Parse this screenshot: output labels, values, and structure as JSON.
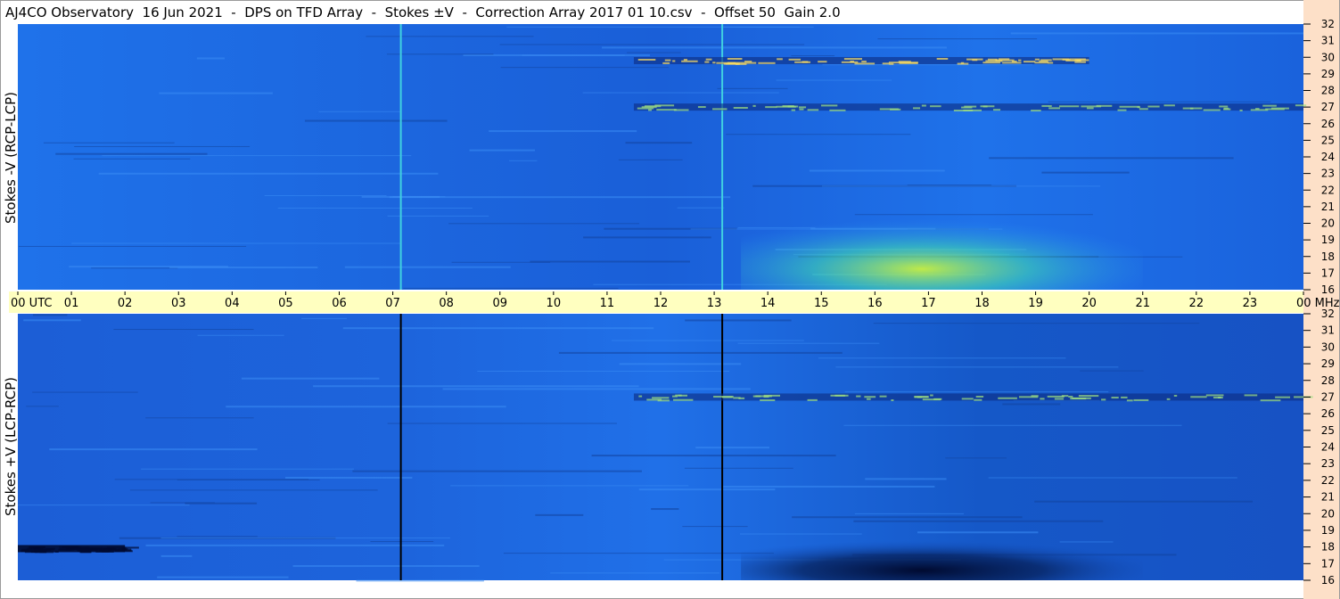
{
  "title": "AJ4CO Observatory  16 Jun 2021  -  DPS on TFD Array  -  Stokes ±V  -  Correction Array 2017 01 10.csv  -  Offset 50  Gain 2.0",
  "panels": {
    "top": {
      "ylabel": "Stokes -V (RCP-LCP)"
    },
    "bottom": {
      "ylabel": "Stokes +V (LCP-RCP)"
    }
  },
  "colors": {
    "background_field": "#1e6ee8",
    "right_strip": "#fde0c8",
    "time_bar": "#ffffc0",
    "hot": "#c8f040",
    "cold": "#000a30"
  },
  "chart_data": {
    "type": "heatmap",
    "title": "AJ4CO Observatory  16 Jun 2021  -  DPS on TFD Array  -  Stokes ±V  -  Correction Array 2017 01 10.csv  -  Offset 50  Gain 2.0",
    "x_axis": {
      "ticks": [
        "00",
        "01",
        "02",
        "03",
        "04",
        "05",
        "06",
        "07",
        "08",
        "09",
        "10",
        "11",
        "12",
        "13",
        "14",
        "15",
        "16",
        "17",
        "18",
        "19",
        "20",
        "21",
        "22",
        "23",
        "00"
      ],
      "first_label_suffix": "UTC",
      "last_label_suffix": "MHz",
      "range_hours": [
        0,
        24
      ]
    },
    "y_axis": {
      "unit": "MHz",
      "ticks": [
        16,
        17,
        18,
        19,
        20,
        21,
        22,
        23,
        24,
        25,
        26,
        27,
        28,
        29,
        30,
        31,
        32
      ],
      "range": [
        16,
        32
      ]
    },
    "panels": [
      {
        "name": "Stokes -V (RCP-LCP)",
        "features": [
          {
            "kind": "vertical_line",
            "utc_hour": 7.15,
            "color": "#40d0e0"
          },
          {
            "kind": "vertical_line",
            "utc_hour": 13.15,
            "color": "#40d0e0"
          },
          {
            "kind": "emission_band",
            "utc_start": 11.5,
            "utc_end": 24,
            "freq_mhz": 27,
            "color": "#a0e080"
          },
          {
            "kind": "emission_band",
            "utc_start": 11.5,
            "utc_end": 20,
            "freq_mhz": 29.8,
            "color": "#ffe060"
          },
          {
            "kind": "emission_blob",
            "utc_start": 13.5,
            "utc_end": 21,
            "freq_start": 16,
            "freq_end": 21,
            "color": "#c8f040"
          }
        ]
      },
      {
        "name": "Stokes +V (LCP-RCP)",
        "features": [
          {
            "kind": "vertical_line",
            "utc_hour": 7.15,
            "color": "#000000"
          },
          {
            "kind": "vertical_line",
            "utc_hour": 13.15,
            "color": "#000000"
          },
          {
            "kind": "emission_band",
            "utc_start": 11.5,
            "utc_end": 24,
            "freq_mhz": 27,
            "color": "#a0e080"
          },
          {
            "kind": "absorption_blob",
            "utc_start": 13.5,
            "utc_end": 21,
            "freq_start": 16,
            "freq_end": 19,
            "color": "#000a30"
          },
          {
            "kind": "absorption_band",
            "utc_start": 0,
            "utc_end": 2,
            "freq_mhz": 17.9,
            "color": "#000a30"
          }
        ]
      }
    ],
    "grid": false,
    "legend": "none"
  }
}
